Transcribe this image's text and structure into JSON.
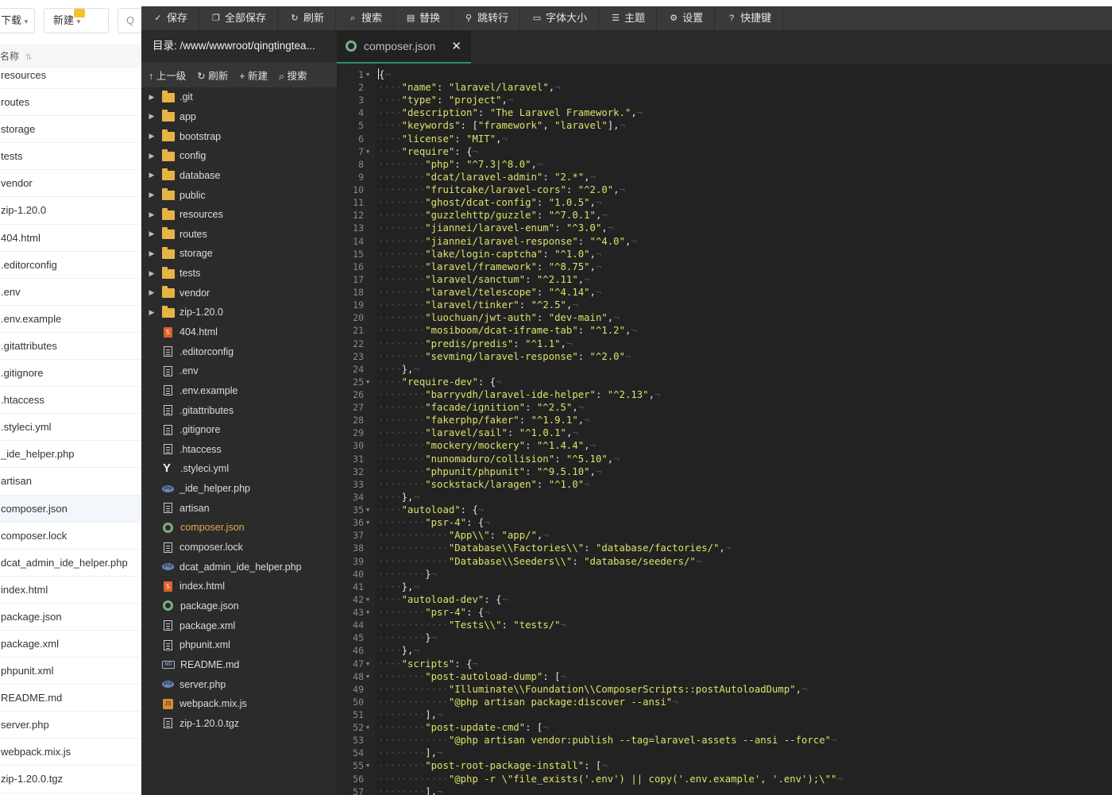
{
  "background_panel": {
    "download_label": "下载",
    "new_label": "新建",
    "search_label": "Q",
    "name_header": "名称",
    "files": [
      "resources",
      "routes",
      "storage",
      "tests",
      "vendor",
      "zip-1.20.0",
      "404.html",
      ".editorconfig",
      ".env",
      ".env.example",
      ".gitattributes",
      ".gitignore",
      ".htaccess",
      ".styleci.yml",
      "_ide_helper.php",
      "artisan",
      "composer.json",
      "composer.lock",
      "dcat_admin_ide_helper.php",
      "index.html",
      "package.json",
      "package.xml",
      "phpunit.xml",
      "README.md",
      "server.php",
      "webpack.mix.js",
      "zip-1.20.0.tgz"
    ],
    "active_file": "composer.json"
  },
  "toolbar": {
    "buttons": [
      {
        "icon": "check-icon",
        "glyph": "✓",
        "label": "保存"
      },
      {
        "icon": "save-all-icon",
        "glyph": "❐",
        "label": "全部保存"
      },
      {
        "icon": "refresh-icon",
        "glyph": "↻",
        "label": "刷新"
      },
      {
        "icon": "search-icon",
        "glyph": "⌕",
        "label": "搜索"
      },
      {
        "icon": "replace-icon",
        "glyph": "▤",
        "label": "替换"
      },
      {
        "icon": "jump-line-icon",
        "glyph": "⚲",
        "label": "跳转行"
      },
      {
        "icon": "font-size-icon",
        "glyph": "▭",
        "label": "字体大小"
      },
      {
        "icon": "theme-icon",
        "glyph": "☰",
        "label": "主题"
      },
      {
        "icon": "settings-icon",
        "glyph": "⚙",
        "label": "设置"
      },
      {
        "icon": "shortcut-icon",
        "glyph": "?",
        "label": "快捷键"
      }
    ]
  },
  "sidebar": {
    "directory_label": "目录: /www/wwwroot/qingtingtea...",
    "tools": [
      {
        "glyph": "↑",
        "label": "上一级"
      },
      {
        "glyph": "↻",
        "label": "刷新"
      },
      {
        "glyph": "+",
        "label": "新建"
      },
      {
        "glyph": "⌕",
        "label": "搜索"
      }
    ],
    "tree": [
      {
        "name": ".git",
        "type": "folder"
      },
      {
        "name": "app",
        "type": "folder"
      },
      {
        "name": "bootstrap",
        "type": "folder"
      },
      {
        "name": "config",
        "type": "folder"
      },
      {
        "name": "database",
        "type": "folder"
      },
      {
        "name": "public",
        "type": "folder"
      },
      {
        "name": "resources",
        "type": "folder"
      },
      {
        "name": "routes",
        "type": "folder"
      },
      {
        "name": "storage",
        "type": "folder"
      },
      {
        "name": "tests",
        "type": "folder"
      },
      {
        "name": "vendor",
        "type": "folder"
      },
      {
        "name": "zip-1.20.0",
        "type": "folder"
      },
      {
        "name": "404.html",
        "type": "html"
      },
      {
        "name": ".editorconfig",
        "type": "file"
      },
      {
        "name": ".env",
        "type": "file"
      },
      {
        "name": ".env.example",
        "type": "file"
      },
      {
        "name": ".gitattributes",
        "type": "file"
      },
      {
        "name": ".gitignore",
        "type": "file"
      },
      {
        "name": ".htaccess",
        "type": "file"
      },
      {
        "name": ".styleci.yml",
        "type": "yml"
      },
      {
        "name": "_ide_helper.php",
        "type": "php"
      },
      {
        "name": "artisan",
        "type": "file"
      },
      {
        "name": "composer.json",
        "type": "json",
        "active": true
      },
      {
        "name": "composer.lock",
        "type": "file"
      },
      {
        "name": "dcat_admin_ide_helper.php",
        "type": "php"
      },
      {
        "name": "index.html",
        "type": "html"
      },
      {
        "name": "package.json",
        "type": "json"
      },
      {
        "name": "package.xml",
        "type": "file"
      },
      {
        "name": "phpunit.xml",
        "type": "file"
      },
      {
        "name": "README.md",
        "type": "md"
      },
      {
        "name": "server.php",
        "type": "php"
      },
      {
        "name": "webpack.mix.js",
        "type": "js"
      },
      {
        "name": "zip-1.20.0.tgz",
        "type": "file"
      }
    ]
  },
  "tab": {
    "label": "composer.json",
    "close_glyph": "✕"
  },
  "code": {
    "foldable_lines": [
      1,
      7,
      25,
      35,
      36,
      42,
      43,
      47,
      48,
      52,
      55
    ],
    "lines": [
      "{",
      "    \"name\": \"laravel/laravel\",",
      "    \"type\": \"project\",",
      "    \"description\": \"The Laravel Framework.\",",
      "    \"keywords\": [\"framework\", \"laravel\"],",
      "    \"license\": \"MIT\",",
      "    \"require\": {",
      "        \"php\": \"^7.3|^8.0\",",
      "        \"dcat/laravel-admin\": \"2.*\",",
      "        \"fruitcake/laravel-cors\": \"^2.0\",",
      "        \"ghost/dcat-config\": \"1.0.5\",",
      "        \"guzzlehttp/guzzle\": \"^7.0.1\",",
      "        \"jiannei/laravel-enum\": \"^3.0\",",
      "        \"jiannei/laravel-response\": \"^4.0\",",
      "        \"lake/login-captcha\": \"^1.0\",",
      "        \"laravel/framework\": \"^8.75\",",
      "        \"laravel/sanctum\": \"^2.11\",",
      "        \"laravel/telescope\": \"^4.14\",",
      "        \"laravel/tinker\": \"^2.5\",",
      "        \"luochuan/jwt-auth\": \"dev-main\",",
      "        \"mosiboom/dcat-iframe-tab\": \"^1.2\",",
      "        \"predis/predis\": \"^1.1\",",
      "        \"sevming/laravel-response\": \"^2.0\"",
      "    },",
      "    \"require-dev\": {",
      "        \"barryvdh/laravel-ide-helper\": \"^2.13\",",
      "        \"facade/ignition\": \"^2.5\",",
      "        \"fakerphp/faker\": \"^1.9.1\",",
      "        \"laravel/sail\": \"^1.0.1\",",
      "        \"mockery/mockery\": \"^1.4.4\",",
      "        \"nunomaduro/collision\": \"^5.10\",",
      "        \"phpunit/phpunit\": \"^9.5.10\",",
      "        \"sockstack/laragen\": \"^1.0\"",
      "    },",
      "    \"autoload\": {",
      "        \"psr-4\": {",
      "            \"App\\\\\": \"app/\",",
      "            \"Database\\\\Factories\\\\\": \"database/factories/\",",
      "            \"Database\\\\Seeders\\\\\": \"database/seeders/\"",
      "        }",
      "    },",
      "    \"autoload-dev\": {",
      "        \"psr-4\": {",
      "            \"Tests\\\\\": \"tests/\"",
      "        }",
      "    },",
      "    \"scripts\": {",
      "        \"post-autoload-dump\": [",
      "            \"Illuminate\\\\Foundation\\\\ComposerScripts::postAutoloadDump\",",
      "            \"@php artisan package:discover --ansi\"",
      "        ],",
      "        \"post-update-cmd\": [",
      "            \"@php artisan vendor:publish --tag=laravel-assets --ansi --force\"",
      "        ],",
      "        \"post-root-package-install\": [",
      "            \"@php -r \\\"file_exists('.env') || copy('.env.example', '.env');\\\"\"",
      "        ],"
    ]
  }
}
